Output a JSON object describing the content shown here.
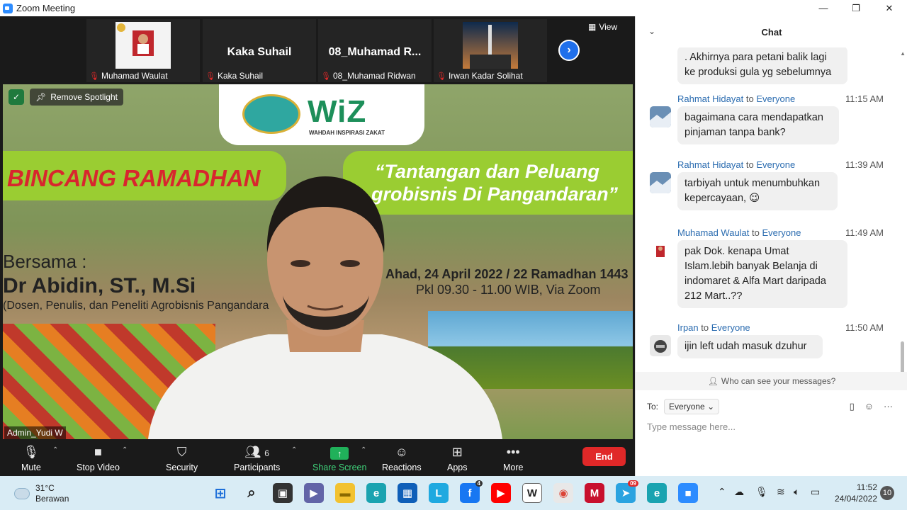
{
  "window": {
    "title": "Zoom Meeting",
    "min": "—",
    "max": "❐",
    "close": "✕"
  },
  "strip": {
    "tiles": [
      {
        "label": "Muhamad Waulat",
        "big": ""
      },
      {
        "label": "Kaka Suhail",
        "big": "Kaka Suhail"
      },
      {
        "label": "08_Muhamad Ridwan",
        "big": "08_Muhamad  R..."
      },
      {
        "label": "Irwan Kadar Solihat",
        "big": ""
      }
    ],
    "view_label": "View"
  },
  "speaker": {
    "remove_spotlight": "Remove Spotlight",
    "name": "Admin_Yudi W",
    "slide": {
      "logo_text": "WiZ",
      "logo_sub": "WAHDAH INSPIRASI ZAKAT",
      "bincang": "BINCANG RAMADHAN",
      "tantangan_line1": "“Tantangan dan Peluang",
      "tantangan_line2": "grobisnis Di Pangandaran”",
      "bersama": "Bersama :",
      "name": "Dr Abidin, ST., M.Si",
      "role": "(Dosen, Penulis, dan Peneliti Agrobisnis Pangandara",
      "date": "Ahad, 24 April 2022 / 22 Ramadhan 1443",
      "time": "Pkl 09.30 - 11.00 WIB, Via Zoom"
    }
  },
  "toolbar": {
    "mute": "Mute",
    "stop_video": "Stop Video",
    "security": "Security",
    "participants": "Participants",
    "participants_count": "6",
    "share_screen": "Share Screen",
    "reactions": "Reactions",
    "apps": "Apps",
    "more": "More",
    "end": "End"
  },
  "chat": {
    "title": "Chat",
    "messages": [
      {
        "sender": "",
        "to": "",
        "time": "",
        "text": ". Akhirnya para petani balik lagi ke produksi gula yg sebelumnya"
      },
      {
        "sender": "Rahmat Hidayat",
        "to": "Everyone",
        "time": "11:15 AM",
        "text": "bagaimana cara mendapatkan pinjaman tanpa bank?"
      },
      {
        "sender": "Rahmat Hidayat",
        "to": "Everyone",
        "time": "11:39 AM",
        "text": "tarbiyah untuk menumbuhkan kepercayaan,"
      },
      {
        "sender": "Muhamad Waulat",
        "to": "Everyone",
        "time": "11:49 AM",
        "text": "pak Dok. kenapa Umat Islam.lebih banyak Belanja di indomaret & Alfa Mart daripada 212 Mart..??"
      },
      {
        "sender": "Irpan",
        "to": "Everyone",
        "time": "11:50 AM",
        "text": "ijin left udah masuk dzuhur"
      }
    ],
    "to_word": "to",
    "emoji": "😉",
    "who_can_see": "Who can see your messages?",
    "to_label": "To:",
    "to_value": "Everyone",
    "placeholder": "Type message here..."
  },
  "taskbar": {
    "temp": "31°C",
    "weather": "Berawan",
    "time": "11:52",
    "date": "24/04/2022",
    "notifications": "10",
    "facebook_badge": "4",
    "telegram_badge": "09"
  }
}
